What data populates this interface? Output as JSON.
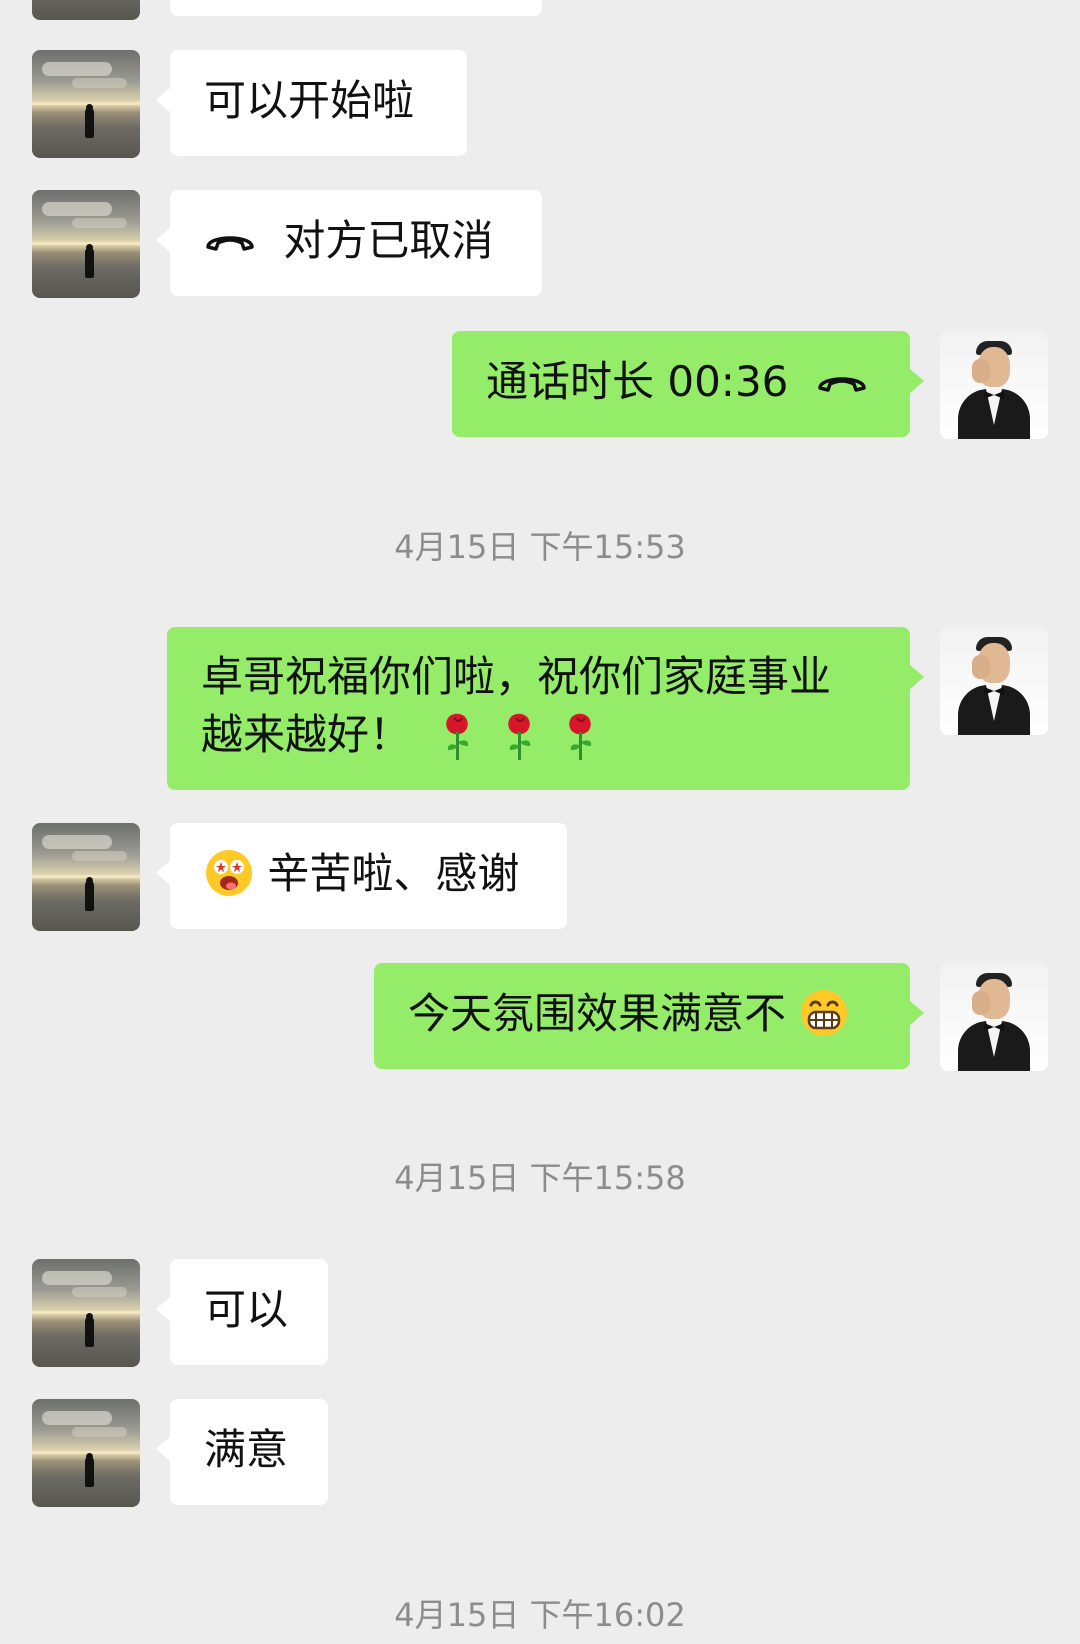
{
  "colors": {
    "background": "#ededed",
    "incoming_bubble": "#ffffff",
    "outgoing_bubble": "#95ec69",
    "timestamp_text": "#8c8c8c"
  },
  "messages": [
    {
      "side": "left",
      "text": "可以开始啦"
    },
    {
      "side": "left",
      "icon": "phone-hangup-icon",
      "text": "对方已取消"
    },
    {
      "side": "right",
      "text": "通话时长 00:36",
      "icon": "phone-hangup-icon"
    },
    {
      "side": "right",
      "text": "卓哥祝福你们啦，祝你们家庭事业越来越好！",
      "emoji": [
        "rose-icon",
        "rose-icon",
        "rose-icon"
      ]
    },
    {
      "side": "left",
      "emoji": "star-struck-face-icon",
      "text": "辛苦啦、感谢"
    },
    {
      "side": "right",
      "text": "今天氛围效果满意不",
      "emoji": "grinning-face-icon"
    },
    {
      "side": "left",
      "text": "可以"
    },
    {
      "side": "left",
      "text": "满意"
    }
  ],
  "timestamps": [
    "4月15日 下午15:53",
    "4月15日 下午15:58",
    "4月15日 下午16:02"
  ]
}
